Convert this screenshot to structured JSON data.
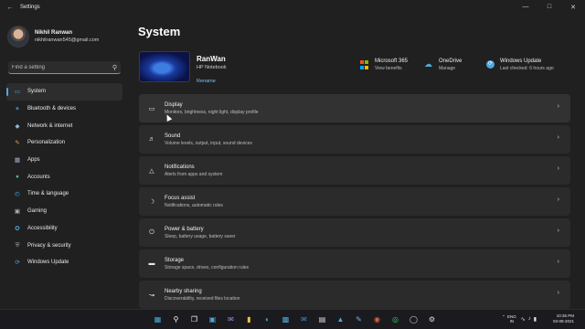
{
  "window": {
    "title": "Settings",
    "back_icon": "back-arrow-icon",
    "controls": [
      "minimize-icon",
      "maximize-icon",
      "close-icon"
    ]
  },
  "profile": {
    "name": "Nikhil Ranwan",
    "email": "nikhilranwan545@gmail.com"
  },
  "search": {
    "placeholder": "Find a setting",
    "value": ""
  },
  "sidebar": {
    "items": [
      {
        "label": "System",
        "icon": "monitor-icon",
        "active": true
      },
      {
        "label": "Bluetooth & devices",
        "icon": "bluetooth-icon"
      },
      {
        "label": "Network & internet",
        "icon": "network-icon"
      },
      {
        "label": "Personalization",
        "icon": "brush-icon"
      },
      {
        "label": "Apps",
        "icon": "apps-icon"
      },
      {
        "label": "Accounts",
        "icon": "person-icon"
      },
      {
        "label": "Time & language",
        "icon": "clock-globe-icon"
      },
      {
        "label": "Gaming",
        "icon": "gamepad-icon"
      },
      {
        "label": "Accessibility",
        "icon": "accessibility-icon"
      },
      {
        "label": "Privacy & security",
        "icon": "shield-icon"
      },
      {
        "label": "Windows Update",
        "icon": "update-icon"
      }
    ]
  },
  "main": {
    "title": "System",
    "device": {
      "name": "RanWan",
      "model": "HP Notebook",
      "rename_label": "Rename"
    },
    "quick_links": [
      {
        "title": "Microsoft 365",
        "subtitle": "View benefits",
        "icon": "microsoft-logo-icon"
      },
      {
        "title": "OneDrive",
        "subtitle": "Manage",
        "icon": "cloud-icon"
      },
      {
        "title": "Windows Update",
        "subtitle": "Last checked: 6 hours ago",
        "icon": "update-icon"
      }
    ],
    "cards": [
      {
        "title": "Display",
        "subtitle": "Monitors, brightness, night light, display profile",
        "icon": "display-icon"
      },
      {
        "title": "Sound",
        "subtitle": "Volume levels, output, input, sound devices",
        "icon": "speaker-icon"
      },
      {
        "title": "Notifications",
        "subtitle": "Alerts from apps and system",
        "icon": "bell-icon"
      },
      {
        "title": "Focus assist",
        "subtitle": "Notifications, automatic rules",
        "icon": "moon-icon"
      },
      {
        "title": "Power & battery",
        "subtitle": "Sleep, battery usage, battery saver",
        "icon": "power-icon"
      },
      {
        "title": "Storage",
        "subtitle": "Storage space, drives, configuration rules",
        "icon": "storage-icon"
      },
      {
        "title": "Nearby sharing",
        "subtitle": "Discoverability, received files location",
        "icon": "share-icon"
      }
    ]
  },
  "taskbar": {
    "apps": [
      "start-icon",
      "search-icon",
      "task-view-icon",
      "widgets-icon",
      "chat-icon",
      "file-explorer-icon",
      "edge-icon",
      "store-icon",
      "mail-icon",
      "calendar-icon",
      "photos-icon",
      "settings-icon",
      "media-icon",
      "chrome-icon",
      "app-icon",
      "settings-gear-icon"
    ],
    "lang_top": "ENG",
    "lang_bottom": "IN",
    "time": "10:35 PM",
    "date": "03-08-2021"
  },
  "colors": {
    "accent": "#4ca8e0",
    "background": "#202020",
    "card": "#2b2b2b"
  }
}
